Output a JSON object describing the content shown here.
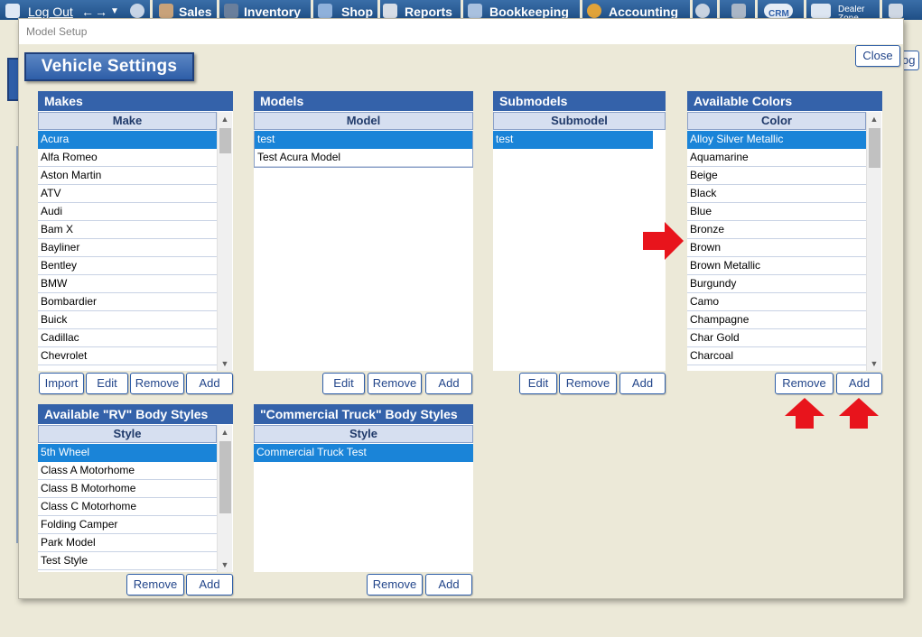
{
  "toolbar": {
    "logout": "Log Out",
    "sales": "Sales",
    "inventory": "Inventory",
    "shop": "Shop",
    "reports": "Reports",
    "bookkeeping": "Bookkeeping",
    "accounting": "Accounting",
    "crm": "CRM",
    "dealer_zone": "Dealer Zone",
    "accent_color": "#2e5ea8"
  },
  "modal": {
    "title": "Model Setup",
    "banner": "Vehicle Settings",
    "close_label": "Close"
  },
  "background": {
    "log_fragment": "og"
  },
  "makes": {
    "title": "Makes",
    "column": "Make",
    "items": [
      "Acura",
      "Alfa Romeo",
      "Aston Martin",
      "ATV",
      "Audi",
      "Bam X",
      "Bayliner",
      "Bentley",
      "BMW",
      "Bombardier",
      "Buick",
      "Cadillac",
      "Chevrolet"
    ],
    "selected_index": 0,
    "buttons": {
      "import": "Import",
      "edit": "Edit",
      "remove": "Remove",
      "add": "Add"
    }
  },
  "models": {
    "title": "Models",
    "column": "Model",
    "items": [
      "test",
      "Test Acura Model"
    ],
    "selected_index": 0,
    "buttons": {
      "edit": "Edit",
      "remove": "Remove",
      "add": "Add"
    }
  },
  "submodels": {
    "title": "Submodels",
    "column": "Submodel",
    "items": [
      "test"
    ],
    "selected_index": 0,
    "buttons": {
      "edit": "Edit",
      "remove": "Remove",
      "add": "Add"
    }
  },
  "colors": {
    "title": "Available Colors",
    "column": "Color",
    "items": [
      "Alloy Silver Metallic",
      "Aquamarine",
      "Beige",
      "Black",
      "Blue",
      "Bronze",
      "Brown",
      "Brown Metallic",
      "Burgundy",
      "Camo",
      "Champagne",
      "Char Gold",
      "Charcoal"
    ],
    "selected_index": 0,
    "buttons": {
      "remove": "Remove",
      "add": "Add"
    }
  },
  "rv_styles": {
    "title": "Available \"RV\" Body Styles",
    "column": "Style",
    "items": [
      "5th Wheel",
      "Class A Motorhome",
      "Class B Motorhome",
      "Class C Motorhome",
      "Folding Camper",
      "Park Model",
      "Test Style"
    ],
    "selected_index": 0,
    "buttons": {
      "remove": "Remove",
      "add": "Add"
    }
  },
  "truck_styles": {
    "title": "\"Commercial Truck\" Body Styles",
    "column": "Style",
    "items": [
      "Commercial Truck Test"
    ],
    "selected_index": 0,
    "buttons": {
      "remove": "Remove",
      "add": "Add"
    }
  },
  "annotations": {
    "arrow_color": "#e8141c"
  }
}
